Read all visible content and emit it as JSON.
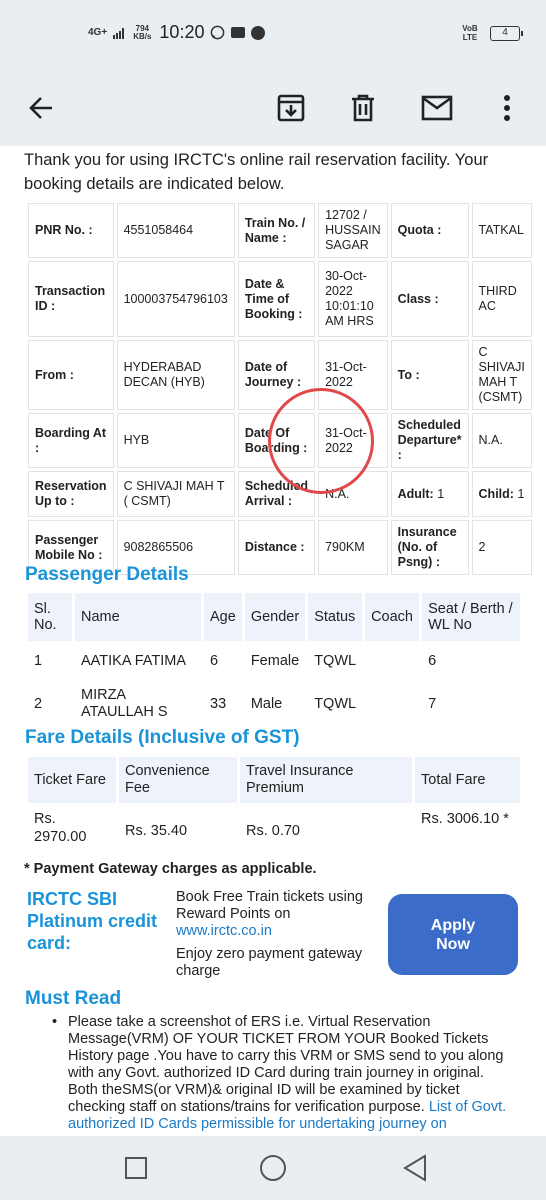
{
  "status_bar": {
    "network": "4G+",
    "speed_value": "794",
    "speed_unit": "KB/s",
    "time": "10:20",
    "volte": "VoB LTE",
    "battery": "4"
  },
  "toolbar": {
    "icons": [
      "back-arrow-icon",
      "archive-icon",
      "delete-icon",
      "mail-icon",
      "more-vert-icon"
    ]
  },
  "intro": "Thank you for using IRCTC's online rail reservation facility. Your booking details are indicated below.",
  "booking": {
    "pnr_label": "PNR No. :",
    "pnr_value": "4551058464",
    "train_label": "Train No. / Name :",
    "train_value": "12702 / HUSSAIN SAGAR",
    "quota_label": "Quota :",
    "quota_value": "TATKAL",
    "txn_label": "Transaction ID :",
    "txn_value": "100003754796103",
    "date_booking_label": "Date & Time of Booking :",
    "date_booking_value": "30-Oct-2022 10:01:10 AM HRS",
    "class_label": "Class :",
    "class_value": "THIRD AC",
    "from_label": "From :",
    "from_value": "HYDERABAD DECAN (HYB)",
    "journey_label": "Date of Journey :",
    "journey_value": "31-Oct-2022",
    "to_label": "To :",
    "to_value": "C SHIVAJI MAH T (CSMT)",
    "boarding_label": "Boarding At :",
    "boarding_value": "HYB",
    "date_boarding_label": "Date Of Boarding :",
    "date_boarding_value": "31-Oct-2022",
    "sched_dep_label": "Scheduled Departure* :",
    "sched_dep_value": "N.A.",
    "resv_upto_label": "Reservation Up to :",
    "resv_upto_value": "C SHIVAJI MAH T ( CSMT)",
    "sched_arr_label": "Scheduled Arrival :",
    "sched_arr_value": "N.A.",
    "adult_label": "Adult:",
    "adult_value": "1",
    "child_label": "Child:",
    "child_value": "1",
    "mobile_label": "Passenger Mobile No :",
    "mobile_value": "9082865506",
    "distance_label": "Distance :",
    "distance_value": "790KM",
    "insurance_label": "Insurance (No. of Psng) :",
    "insurance_value": "2"
  },
  "passenger_details": {
    "title": "Passenger Details",
    "headers": [
      "Sl. No.",
      "Name",
      "Age",
      "Gender",
      "Status",
      "Coach",
      "Seat / Berth / WL No"
    ],
    "rows": [
      [
        "1",
        "AATIKA FATIMA",
        "6",
        "Female",
        "TQWL",
        "",
        "6"
      ],
      [
        "2",
        "MIRZA ATAULLAH S",
        "33",
        "Male",
        "TQWL",
        "",
        "7"
      ]
    ]
  },
  "fare_details": {
    "title": "Fare Details (Inclusive of GST)",
    "headers": [
      "Ticket Fare",
      "Convenience Fee",
      "Travel Insurance Premium",
      "Total Fare"
    ],
    "values": [
      "Rs. 2970.00",
      "Rs. 35.40",
      "Rs. 0.70",
      "Rs. 3006.10 *"
    ]
  },
  "payment_note": "* Payment Gateway charges as applicable.",
  "sbi_card": {
    "title": "IRCTC SBI Platinum credit card:",
    "line1": "Book Free Train tickets using Reward Points on",
    "link": "www.irctc.co.in",
    "line2": "Enjoy zero payment gateway charge",
    "button": "Apply Now"
  },
  "must_read": {
    "title": "Must Read",
    "bullet": "•",
    "text": "Please take a screenshot of ERS i.e. Virtual Reservation Message(VRM) OF YOUR TICKET FROM YOUR Booked Tickets History page .You have to carry this VRM or SMS send to you along with any Govt. authorized ID Card during train journey in original. Both theSMS(or VRM)& original ID will be examined by ticket checking staff on stations/trains for verification purpose.",
    "link": "List of Govt. authorized ID Cards permissible for undertaking journey on"
  },
  "navbar": {
    "icons": [
      "recents-square-icon",
      "home-circle-icon",
      "back-triangle-icon"
    ]
  }
}
